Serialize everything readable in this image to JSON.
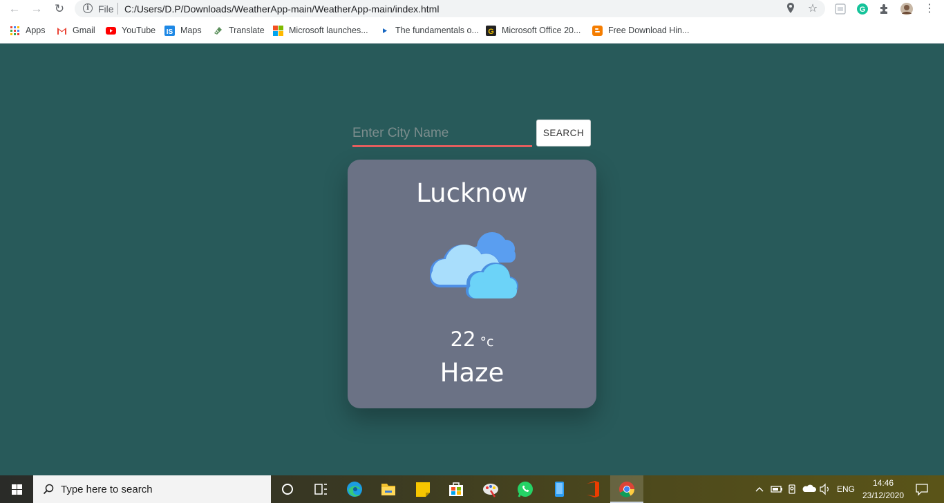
{
  "browser": {
    "url_scheme": "File",
    "url": "C:/Users/D.P/Downloads/WeatherApp-main/WeatherApp-main/index.html",
    "bookmarks": [
      {
        "label": "Apps"
      },
      {
        "label": "Gmail"
      },
      {
        "label": "YouTube"
      },
      {
        "label": "Maps"
      },
      {
        "label": "Translate"
      },
      {
        "label": "Microsoft launches..."
      },
      {
        "label": "The fundamentals o..."
      },
      {
        "label": "Microsoft Office 20..."
      },
      {
        "label": "Free Download Hin..."
      }
    ]
  },
  "search": {
    "placeholder": "Enter City Name",
    "button_label": "SEARCH"
  },
  "weather": {
    "city": "Lucknow",
    "icon": "cloudy-icon",
    "temperature": "22",
    "unit": "°c",
    "condition": "Haze"
  },
  "taskbar": {
    "search_placeholder": "Type here to search",
    "language": "ENG",
    "time": "14:46",
    "date": "23/12/2020"
  },
  "colors": {
    "page_background": "#285a5a",
    "card_background": "#6b7285",
    "input_underline": "#e55e5e"
  }
}
